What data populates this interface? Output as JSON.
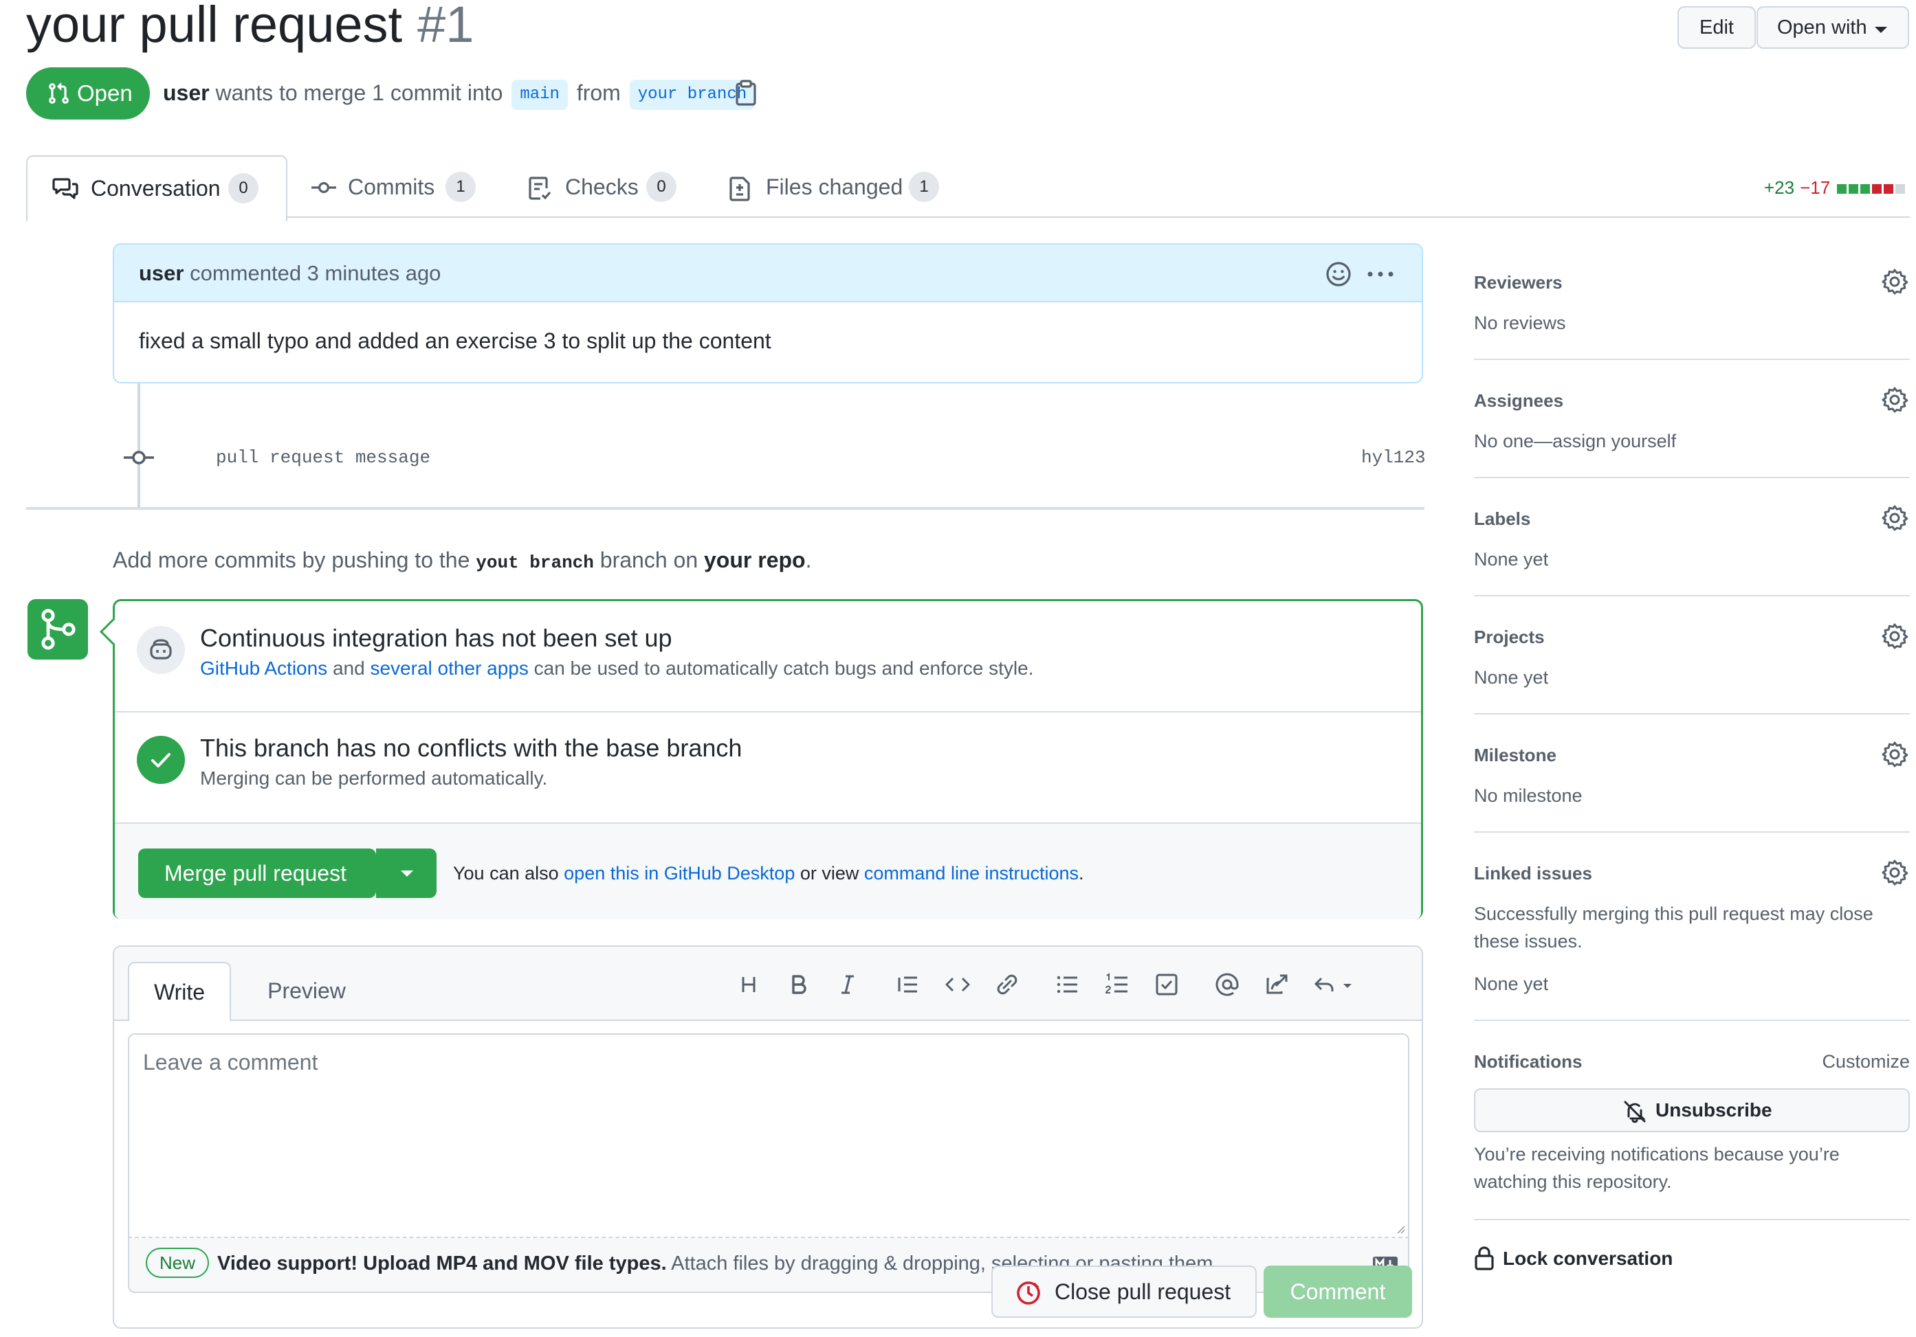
{
  "header": {
    "title": "your pull request",
    "number": "#1",
    "edit_label": "Edit",
    "open_with_label": "Open with",
    "state": "Open",
    "author": "user",
    "merge_text": "wants to merge 1 commit into",
    "base_branch": "main",
    "from_text": "from",
    "head_branch": "your branch"
  },
  "tabs": [
    {
      "label": "Conversation",
      "count": "0",
      "icon": "comment-discussion-icon"
    },
    {
      "label": "Commits",
      "count": "1",
      "icon": "git-commit-icon"
    },
    {
      "label": "Checks",
      "count": "0",
      "icon": "checklist-icon"
    },
    {
      "label": "Files changed",
      "count": "1",
      "icon": "file-diff-icon"
    }
  ],
  "diffstat": {
    "additions": "+23",
    "deletions": "−17",
    "colors": [
      "#2da44e",
      "#2da44e",
      "#2da44e",
      "#cf222e",
      "#cf222e",
      "#d0d7de"
    ]
  },
  "comment": {
    "author": "user",
    "meta": "commented 3 minutes ago",
    "body": "fixed a small typo and added an exercise 3 to split up the content"
  },
  "commit": {
    "message": "pull request message",
    "sha": "hyl123"
  },
  "add_commits": {
    "prefix": "Add more commits by pushing to the",
    "branch": "yout branch",
    "middle": "branch on",
    "repo": "your repo",
    "suffix": "."
  },
  "merge_box": {
    "ci_title": "Continuous integration has not been set up",
    "ci_link1": "GitHub Actions",
    "ci_and": "and",
    "ci_link2": "several other apps",
    "ci_rest": "can be used to automatically catch bugs and enforce style.",
    "nc_title": "This branch has no conflicts with the base branch",
    "nc_sub": "Merging can be performed automatically.",
    "merge_label": "Merge pull request",
    "hint_prefix": "You can also",
    "hint_link1": "open this in GitHub Desktop",
    "hint_mid": "or view",
    "hint_link2": "command line instructions",
    "hint_suffix": "."
  },
  "form": {
    "write_tab": "Write",
    "preview_tab": "Preview",
    "placeholder": "Leave a comment",
    "new_badge": "New",
    "attach_bold": "Video support! Upload MP4 and MOV file types.",
    "attach_rest": "Attach files by dragging & dropping, selecting or pasting them.",
    "close_label": "Close pull request",
    "comment_label": "Comment"
  },
  "sidebar": {
    "reviewers": {
      "title": "Reviewers",
      "value": "No reviews"
    },
    "assignees": {
      "title": "Assignees",
      "value": "No one—assign yourself"
    },
    "labels": {
      "title": "Labels",
      "value": "None yet"
    },
    "projects": {
      "title": "Projects",
      "value": "None yet"
    },
    "milestone": {
      "title": "Milestone",
      "value": "No milestone"
    },
    "linked_issues": {
      "title": "Linked issues",
      "line1": "Successfully merging this pull request may close",
      "line2": "these issues.",
      "value": "None yet"
    },
    "notifications": {
      "title": "Notifications",
      "customize": "Customize",
      "unsubscribe": "Unsubscribe",
      "line1": "You’re receiving notifications because you’re",
      "line2": "watching this repository."
    },
    "lock": "Lock conversation"
  }
}
